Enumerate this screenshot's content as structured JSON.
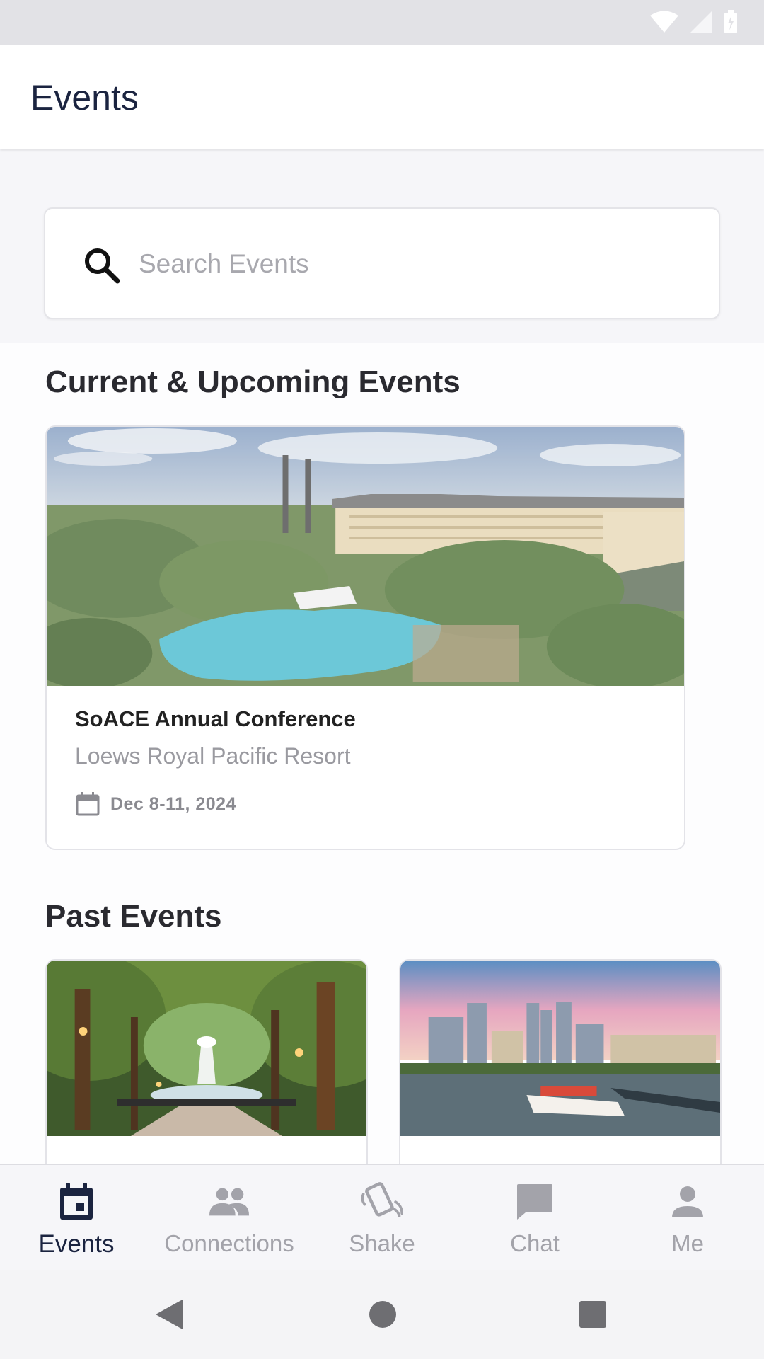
{
  "status_bar": {
    "icons": [
      "wifi-icon",
      "signal-icon",
      "battery-icon"
    ]
  },
  "header": {
    "title": "Events"
  },
  "search": {
    "placeholder": "Search Events"
  },
  "current_section": {
    "title": "Current & Upcoming Events",
    "events": [
      {
        "name": "SoACE Annual Conference",
        "venue": "Loews Royal Pacific Resort",
        "date": "Dec 8-11, 2024"
      }
    ]
  },
  "past_section": {
    "title": "Past Events",
    "events": [
      {
        "image": "park-fountain-photo"
      },
      {
        "image": "city-riverfront-photo"
      }
    ]
  },
  "bottom_nav": {
    "items": [
      {
        "label": "Events",
        "icon": "calendar-icon",
        "active": true
      },
      {
        "label": "Connections",
        "icon": "people-icon",
        "active": false
      },
      {
        "label": "Shake",
        "icon": "shake-phone-icon",
        "active": false
      },
      {
        "label": "Chat",
        "icon": "chat-bubble-icon",
        "active": false
      },
      {
        "label": "Me",
        "icon": "person-icon",
        "active": false
      }
    ]
  },
  "system_nav": {
    "buttons": [
      "back-icon",
      "home-icon",
      "recents-icon"
    ]
  },
  "colors": {
    "primary": "#1b2440",
    "inactive": "#a3a3aa",
    "background": "#f6f6f9"
  }
}
